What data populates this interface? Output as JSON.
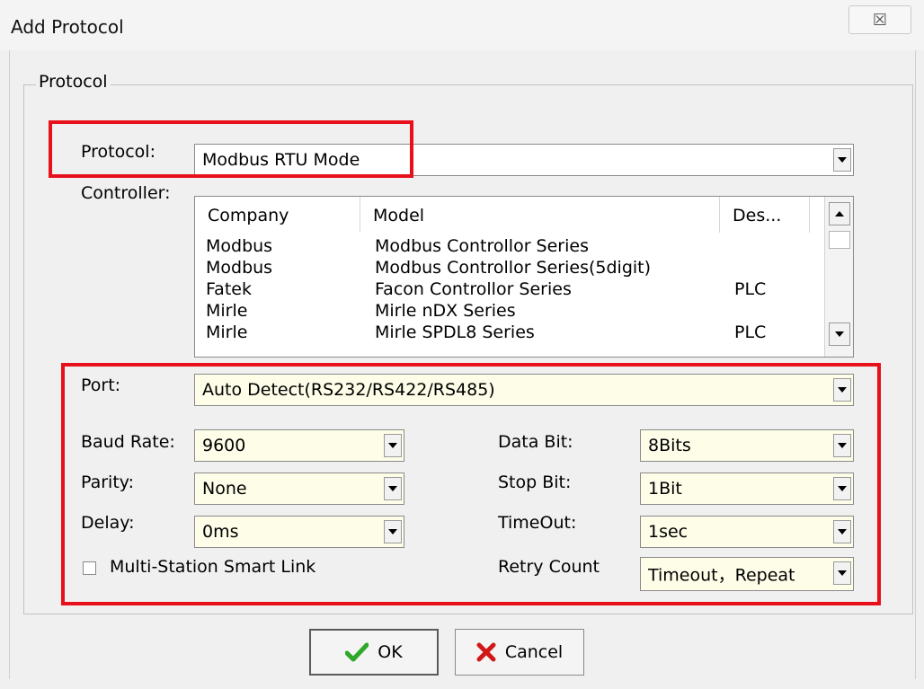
{
  "window": {
    "title": "Add Protocol",
    "close_glyph": "☒"
  },
  "group": {
    "legend": "Protocol"
  },
  "protocol": {
    "label": "Protocol:",
    "value": "Modbus RTU Mode"
  },
  "controller": {
    "label": "Controller:",
    "columns": [
      "Company",
      "Model",
      "Des..."
    ],
    "rows": [
      {
        "company": "Modbus",
        "model": "Modbus Controllor Series",
        "desc": ""
      },
      {
        "company": "Modbus",
        "model": "Modbus Controllor Series(5digit)",
        "desc": ""
      },
      {
        "company": "Fatek",
        "model": "Facon Controllor Series",
        "desc": "PLC"
      },
      {
        "company": "Mirle",
        "model": "Mirle nDX Series",
        "desc": ""
      },
      {
        "company": "Mirle",
        "model": "Mirle SPDL8 Series",
        "desc": "PLC"
      }
    ]
  },
  "port": {
    "label": "Port:",
    "value": "Auto Detect(RS232/RS422/RS485)"
  },
  "baud_rate": {
    "label": "Baud Rate:",
    "value": "9600"
  },
  "parity": {
    "label": "Parity:",
    "value": "None"
  },
  "delay": {
    "label": "Delay:",
    "value": "0ms"
  },
  "data_bit": {
    "label": "Data Bit:",
    "value": "8Bits"
  },
  "stop_bit": {
    "label": "Stop Bit:",
    "value": "1Bit"
  },
  "timeout": {
    "label": "TimeOut:",
    "value": "1sec"
  },
  "retry_count": {
    "label": "Retry Count",
    "value": "Timeout，Repeat"
  },
  "multi_station": {
    "label": "Multi-Station Smart Link",
    "checked": false
  },
  "buttons": {
    "ok": "OK",
    "cancel": "Cancel"
  },
  "colors": {
    "highlight_border": "#e8111b",
    "field_yellow": "#fefde8",
    "ok_check": "#2fa82a",
    "cancel_x": "#d01818"
  }
}
